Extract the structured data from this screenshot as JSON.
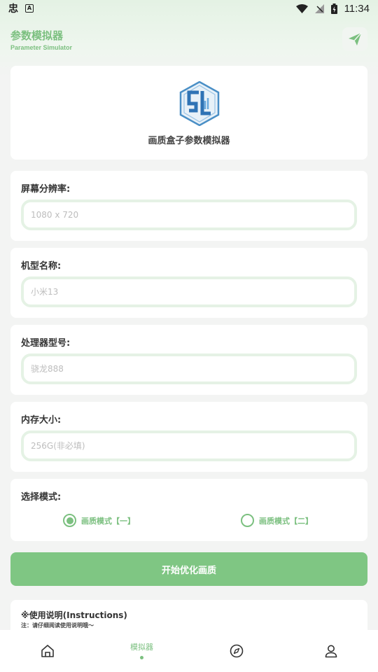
{
  "status_bar": {
    "left_icon_1": "忠",
    "left_icon_2": "A",
    "time": "11:34",
    "icons": [
      "wifi-icon",
      "signal-off-icon",
      "battery-icon"
    ]
  },
  "app_bar": {
    "title": "参数模拟器",
    "subtitle": "Parameter Simulator",
    "action_icon": "send-icon"
  },
  "logo": {
    "caption": "画质盒子参数模拟器"
  },
  "fields": [
    {
      "label": "屏幕分辨率:",
      "placeholder": "1080 x 720"
    },
    {
      "label": "机型名称:",
      "placeholder": "小米13"
    },
    {
      "label": "处理器型号:",
      "placeholder": "骁龙888"
    },
    {
      "label": "内存大小:",
      "placeholder": "256G(非必填)"
    }
  ],
  "mode": {
    "label": "选择模式:",
    "options": [
      {
        "label": "画质模式【一】",
        "selected": true
      },
      {
        "label": "画质模式【二】",
        "selected": false
      }
    ]
  },
  "start_button": "开始优化画质",
  "instructions": {
    "title": "※使用说明(Instructions)",
    "note": "注：请仔细阅读使用说明哦～"
  },
  "bottom_nav": {
    "items": [
      {
        "icon": "home-icon",
        "label": ""
      },
      {
        "icon": "",
        "label": "模拟器",
        "active": true
      },
      {
        "icon": "compass-icon",
        "label": ""
      },
      {
        "icon": "user-icon",
        "label": ""
      }
    ]
  },
  "colors": {
    "accent": "#7cc080",
    "button": "#7fc683",
    "input_border": "#e5f2e5",
    "background": "#f3f4f3"
  }
}
